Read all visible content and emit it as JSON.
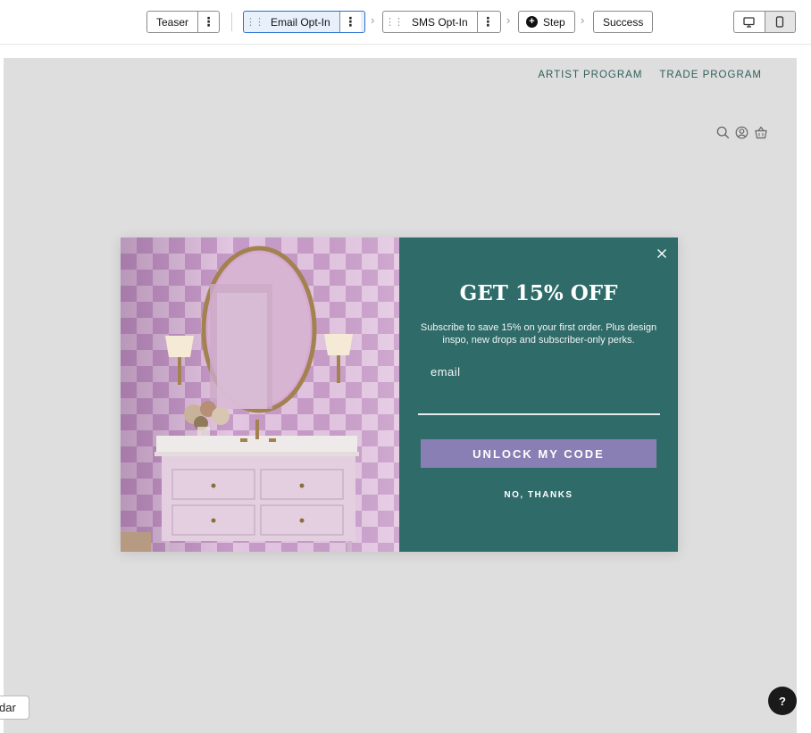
{
  "toolbar": {
    "steps": [
      {
        "label": "Teaser"
      },
      {
        "label": "Email Opt-In",
        "active": true
      },
      {
        "label": "SMS Opt-In"
      },
      {
        "label": "Step"
      },
      {
        "label": "Success"
      }
    ],
    "device_views": [
      "desktop",
      "mobile"
    ],
    "selected_device": "mobile"
  },
  "site": {
    "nav": [
      "ARTIST PROGRAM",
      "TRADE PROGRAM"
    ],
    "icons": [
      "search-icon",
      "account-icon",
      "cart-icon"
    ]
  },
  "popup": {
    "headline": "GET 15% OFF",
    "subtext": "Subscribe to save 15% on your first order. Plus design inspo, new drops and subscriber-only perks.",
    "email_placeholder": "email",
    "cta_label": "UNLOCK MY CODE",
    "decline_label": "NO, THANKS",
    "colors": {
      "panel": "#2f6b69",
      "button": "#8a7fb5"
    }
  },
  "widgets": {
    "side_tab_label": "dar",
    "help_label": "?"
  }
}
